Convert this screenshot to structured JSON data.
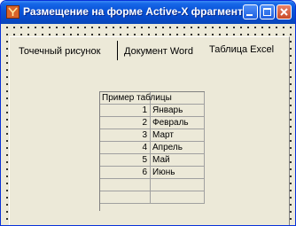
{
  "window": {
    "title": "Размещение на форме Active-X фрагментов"
  },
  "tabs": [
    {
      "label": "Точечный рисунок"
    },
    {
      "label": "Документ Word"
    },
    {
      "label": "Таблица Excel"
    }
  ],
  "sheet": {
    "header": "Пример таблицы",
    "rows": [
      {
        "num": "1",
        "month": "Январь"
      },
      {
        "num": "2",
        "month": "Февраль"
      },
      {
        "num": "3",
        "month": "Март"
      },
      {
        "num": "4",
        "month": "Апрель"
      },
      {
        "num": "5",
        "month": "Май"
      },
      {
        "num": "6",
        "month": "Июнь"
      }
    ],
    "empty_rows": 2
  },
  "colors": {
    "title_bar": "#0a55d9",
    "window_bg": "#ece9d8",
    "close_button": "#c84a26"
  }
}
